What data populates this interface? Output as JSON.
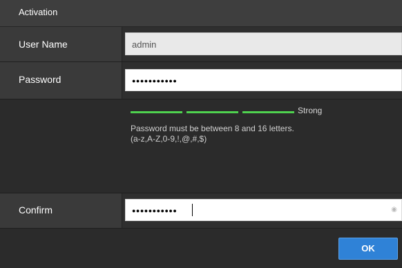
{
  "dialog": {
    "title": "Activation"
  },
  "user_name": {
    "label": "User Name",
    "value": "admin"
  },
  "password": {
    "label": "Password",
    "masked_value": "●●●●●●●●●●●"
  },
  "strength": {
    "text": "Strong",
    "level": "3 of 3",
    "bar_color": "#4fd24f"
  },
  "hint": {
    "line1": "Password must be between 8 and 16 letters.",
    "line2": "(a-z,A-Z,0-9,!,@,#,$)"
  },
  "confirm": {
    "label": "Confirm",
    "masked_value": "●●●●●●●●●●●"
  },
  "buttons": {
    "ok_label": "OK"
  },
  "colors": {
    "accent": "#2f82d7",
    "background": "#2b2b2b"
  }
}
